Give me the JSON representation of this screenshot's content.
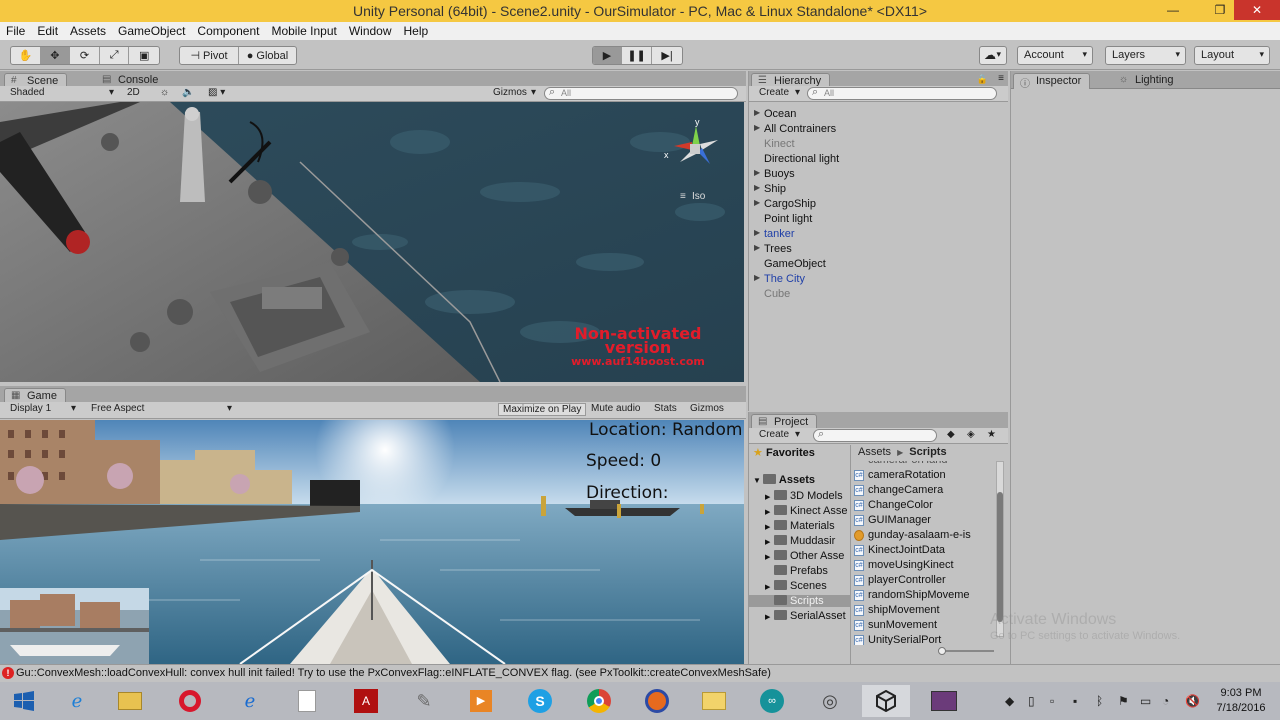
{
  "window": {
    "title": "Unity Personal (64bit) - Scene2.unity - OurSimulator - PC, Mac & Linux Standalone* <DX11>",
    "controls": [
      "—",
      "❐",
      "✕"
    ]
  },
  "menu": [
    "File",
    "Edit",
    "Assets",
    "GameObject",
    "Component",
    "Mobile Input",
    "Window",
    "Help"
  ],
  "toolbar": {
    "pivot_label": "Pivot",
    "global_label": "Global",
    "account_label": "Account",
    "layers_label": "Layers",
    "layout_label": "Layout"
  },
  "scene_panel": {
    "tabs": [
      "Scene",
      "Console"
    ],
    "shading": "Shaded",
    "mode_2d": "2D",
    "gizmos": "Gizmos",
    "search_placeholder": "All",
    "projection": "Iso",
    "gizmo_axes": {
      "x": "x",
      "y": "y"
    },
    "watermark": [
      "Non-activated",
      "version",
      "www.auf14boost.com"
    ]
  },
  "game_panel": {
    "tab": "Game",
    "display": "Display 1",
    "aspect": "Free Aspect",
    "maximize": "Maximize on Play",
    "mute": "Mute audio",
    "stats": "Stats",
    "gizmos": "Gizmos",
    "hud": {
      "location": "Location: Random",
      "speed": "Speed: 0",
      "direction": "Direction:"
    }
  },
  "hierarchy": {
    "tab": "Hierarchy",
    "create": "Create",
    "search_placeholder": "All",
    "items": [
      {
        "label": "Ocean",
        "arrow": true,
        "style": "normal"
      },
      {
        "label": "All Contrainers",
        "arrow": true,
        "style": "normal"
      },
      {
        "label": "Kinect",
        "arrow": false,
        "style": "dim"
      },
      {
        "label": "Directional light",
        "arrow": false,
        "style": "normal"
      },
      {
        "label": "Buoys",
        "arrow": true,
        "style": "normal"
      },
      {
        "label": "Ship",
        "arrow": true,
        "style": "normal"
      },
      {
        "label": "CargoShip",
        "arrow": true,
        "style": "normal"
      },
      {
        "label": "Point light",
        "arrow": false,
        "style": "normal"
      },
      {
        "label": "tanker",
        "arrow": true,
        "style": "blue"
      },
      {
        "label": "Trees",
        "arrow": true,
        "style": "normal"
      },
      {
        "label": "GameObject",
        "arrow": false,
        "style": "normal"
      },
      {
        "label": "The City",
        "arrow": true,
        "style": "blue"
      },
      {
        "label": "Cube",
        "arrow": false,
        "style": "dim"
      }
    ]
  },
  "inspector": {
    "tabs": [
      "Inspector",
      "Lighting"
    ]
  },
  "project": {
    "tab": "Project",
    "create": "Create",
    "favorites": "Favorites",
    "assets": "Assets",
    "breadcrumb": [
      "Assets",
      "Scripts"
    ],
    "folders": [
      "3D Models",
      "Kinect Asse",
      "Materials",
      "Muddasir",
      "Other Asse",
      "Prefabs",
      "Scenes",
      "Scripts",
      "SerialAsset"
    ],
    "scripts": [
      "cameraRotation",
      "changeCamera",
      "ChangeColor",
      "GUIManager",
      "gunday-asalaam-e-is",
      "KinectJointData",
      "moveUsingKinect",
      "playerController",
      "randomShipMoveme",
      "shipMovement",
      "sunMovement",
      "UnitySerialPort"
    ],
    "partial_top": "cameraForHand"
  },
  "status": {
    "message": "Gu::ConvexMesh::loadConvexHull: convex hull init failed! Try to use the PxConvexFlag::eINFLATE_CONVEX flag. (see PxToolkit::createConvexMeshSafe)"
  },
  "activate": {
    "line1": "Activate Windows",
    "line2": "Go to PC settings to activate Windows."
  },
  "taskbar": {
    "time": "9:03 PM",
    "date": "7/18/2016"
  }
}
